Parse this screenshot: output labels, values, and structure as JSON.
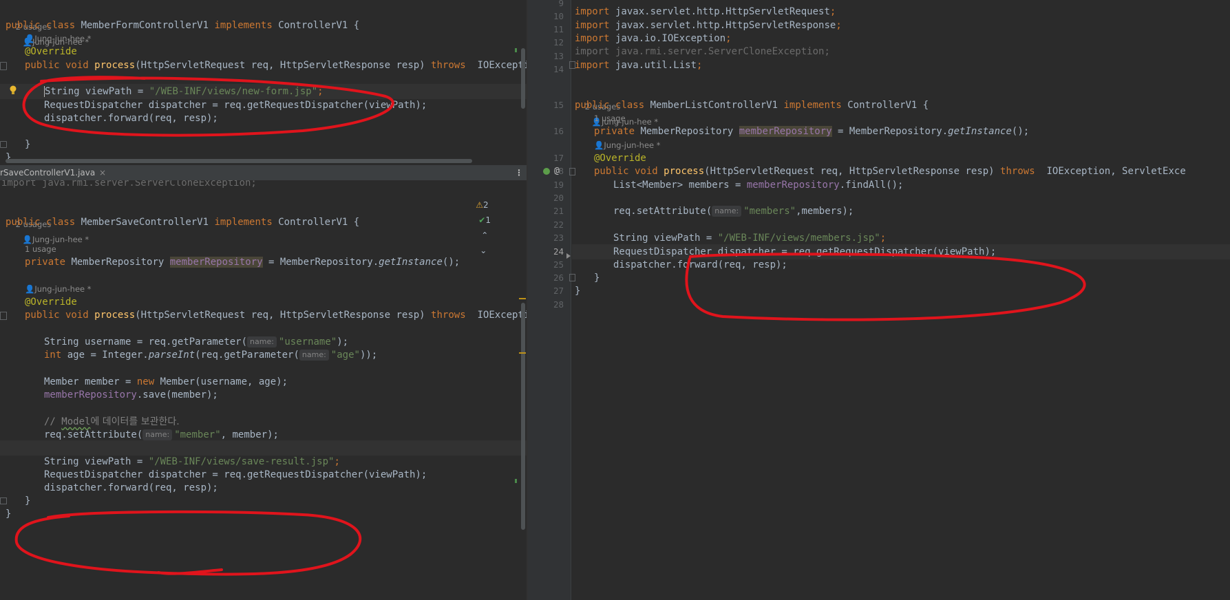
{
  "top_left": {
    "usages": "2 usages",
    "author": "Jung-jun-hee *",
    "class_decl": {
      "kw_public": "public",
      "kw_class": "class",
      "name": "MemberFormControllerV1",
      "kw_implements": "implements",
      "iface": "ControllerV1 {"
    },
    "author2": "Jung-jun-hee *",
    "override": "@Override",
    "method": {
      "mods": "public void ",
      "name": "process",
      "params": "(HttpServletRequest req, HttpServletResponse resp) ",
      "throws": "throws",
      "exc": "  IOException, ServletExcept"
    },
    "l1": {
      "type": "String",
      "rest": " viewPath = ",
      "str": "\"/WEB-INF/views/new-form.jsp\"",
      "end": ";"
    },
    "l2": "RequestDispatcher dispatcher = req.getRequestDispatcher(viewPath);",
    "l3": "dispatcher.forward(req, resp);",
    "close1": "}",
    "close2": "}"
  },
  "bottom_left": {
    "tab_label": "rSaveControllerV1.java",
    "tab_close": "×",
    "more": "⋮",
    "scrolled_import": "import java.rmi.server.ServerCloneException;",
    "warnings": "2",
    "checks": "1",
    "usages": "2 usages",
    "author": "Jung-jun-hee *",
    "class_decl": {
      "kw_public": "public",
      "kw_class": "class",
      "name": "MemberSaveControllerV1",
      "kw_implements": "implements",
      "iface": "ControllerV1 {"
    },
    "field_usage": "1 usage",
    "field": {
      "mods": "private ",
      "type": "MemberRepository ",
      "name": "memberRepository",
      "assign": " = MemberRepository.",
      "call": "getInstance",
      "end": "();"
    },
    "author2": "Jung-jun-hee *",
    "override": "@Override",
    "method": {
      "mods": "public void ",
      "name": "process",
      "params": "(HttpServletRequest req, HttpServletResponse resp) ",
      "throws": "throws",
      "exc": "  IOException, ServletExcept"
    },
    "username_line": {
      "pre": "String username = req.getParameter(",
      "hint": "name:",
      "str": "\"username\"",
      "end": ");"
    },
    "age_line": {
      "kw": "int",
      "pre": " age = Integer.",
      "call": "parseInt",
      "mid": "(req.getParameter(",
      "hint": "name:",
      "str": "\"age\"",
      "end": "));"
    },
    "member_line": {
      "pre": "Member member = ",
      "kw": "new",
      "rest": " Member(username, age);"
    },
    "save_line": {
      "fld": "memberRepository",
      "rest": ".save(member);"
    },
    "comment": {
      "pre": "// ",
      "model": "Model",
      "rest": "에 데이터를 보관한다."
    },
    "setattr": {
      "pre": "req.setAttribute(",
      "hint": "name:",
      "str": "\"member\"",
      "end": ", member);"
    },
    "l1": {
      "type": "String",
      "rest": " viewPath = ",
      "str": "\"/WEB-INF/views/save-result.jsp\"",
      "end": ";"
    },
    "l2": "RequestDispatcher dispatcher = req.getRequestDispatcher(viewPath);",
    "l3": "dispatcher.forward(req, resp);",
    "close1": "}",
    "close2": "}"
  },
  "right": {
    "line_numbers": [
      "9",
      "10",
      "11",
      "12",
      "13",
      "14",
      "15",
      "16",
      "17",
      "18",
      "19",
      "20",
      "21",
      "22",
      "23",
      "24",
      "25",
      "26",
      "27",
      "28"
    ],
    "imports": [
      {
        "kw": "import",
        "path": " javax.servlet.http.HttpServletRequest",
        "end": ";",
        "dim": false
      },
      {
        "kw": "import",
        "path": " javax.servlet.http.HttpServletResponse",
        "end": ";",
        "dim": false
      },
      {
        "kw": "import",
        "path": " java.io.IOException",
        "end": ";",
        "dim": false
      },
      {
        "kw": "import",
        "path": " java.rmi.server.ServerCloneException",
        "end": ";",
        "dim": true
      },
      {
        "kw": "import",
        "path": " java.util.List",
        "end": ";",
        "dim": false
      }
    ],
    "usages": "2 usages",
    "author": "Jung-jun-hee *",
    "class_decl": {
      "kw_public": "public",
      "kw_class": "class",
      "name": "MemberListControllerV1",
      "kw_implements": "implements",
      "iface": "ControllerV1 {"
    },
    "field_usage": "1 usage",
    "field": {
      "mods": "private ",
      "type": "MemberRepository ",
      "name": "memberRepository",
      "assign": " = MemberRepository.",
      "call": "getInstance",
      "end": "();"
    },
    "author2": "Jung-jun-hee *",
    "override": "@Override",
    "method": {
      "mods": "public void ",
      "name": "process",
      "params": "(HttpServletRequest req, HttpServletResponse resp) ",
      "throws": "throws",
      "exc": "  IOException, ServletExce"
    },
    "list_line": {
      "pre": "List<Member> members = ",
      "fld": "memberRepository",
      "rest": ".findAll();"
    },
    "setattr": {
      "pre": "req.setAttribute(",
      "hint": "name:",
      "str": "\"members\"",
      "end": ",members);"
    },
    "l1": {
      "type": "String",
      "rest": " viewPath = ",
      "str": "\"/WEB-INF/views/members.jsp\"",
      "end": ";"
    },
    "l2": "RequestDispatcher dispatcher = req.getRequestDispatcher(viewPath);",
    "l3": "dispatcher.forward(req, resp);",
    "close1": "}",
    "close2": "}",
    "gutter_at": "@"
  },
  "colors": {
    "annotation_red": "#e0141c",
    "keyword": "#cc7832",
    "string": "#6a8759",
    "annotation": "#bbb529",
    "method": "#ffc66d",
    "field": "#9876aa"
  }
}
